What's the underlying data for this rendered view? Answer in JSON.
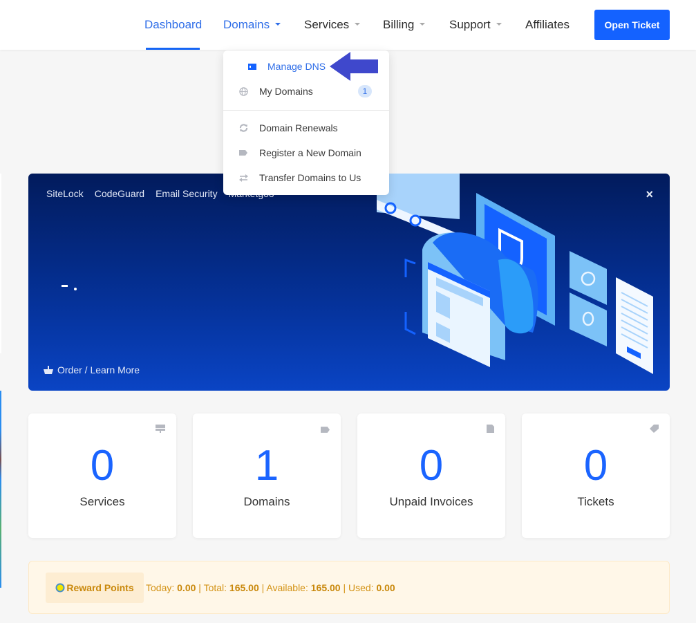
{
  "nav": {
    "items": [
      {
        "label": "Dashboard",
        "active": true,
        "has_dropdown": false
      },
      {
        "label": "Domains",
        "active": false,
        "has_dropdown": true
      },
      {
        "label": "Services",
        "active": false,
        "has_dropdown": true
      },
      {
        "label": "Billing",
        "active": false,
        "has_dropdown": true
      },
      {
        "label": "Support",
        "active": false,
        "has_dropdown": true
      },
      {
        "label": "Affiliates",
        "active": false,
        "has_dropdown": false
      }
    ],
    "open_ticket_label": "Open Ticket"
  },
  "domains_dropdown": {
    "items": [
      {
        "label": "Manage DNS",
        "icon": "dns-card-icon",
        "highlighted": true
      },
      {
        "label": "My Domains",
        "icon": "globe-icon",
        "badge": "1"
      },
      {
        "label": "Domain Renewals",
        "icon": "sync-icon"
      },
      {
        "label": "Register a New Domain",
        "icon": "tag-icon"
      },
      {
        "label": "Transfer Domains to Us",
        "icon": "exchange-icon"
      }
    ]
  },
  "banner": {
    "tabs": [
      "SiteLock",
      "CodeGuard",
      "Email Security",
      "Marketgoo"
    ],
    "order_label": "Order / Learn More",
    "close_label": "×"
  },
  "stats": [
    {
      "value": "0",
      "label": "Services",
      "icon": "server-icon"
    },
    {
      "value": "1",
      "label": "Domains",
      "icon": "tag-icon"
    },
    {
      "value": "0",
      "label": "Unpaid Invoices",
      "icon": "file-icon"
    },
    {
      "value": "0",
      "label": "Tickets",
      "icon": "ticket-icon"
    }
  ],
  "reward": {
    "title": "Reward Points",
    "today_label": "Today:",
    "today": "0.00",
    "total_label": "Total:",
    "total": "165.00",
    "available_label": "Available:",
    "available": "165.00",
    "used_label": "Used:",
    "used": "0.00",
    "separator": "|"
  },
  "colors": {
    "accent": "#1462ff",
    "banner_dark": "#021b5c",
    "reward_text": "#c9880b",
    "annotation_arrow": "#3f48cc"
  }
}
